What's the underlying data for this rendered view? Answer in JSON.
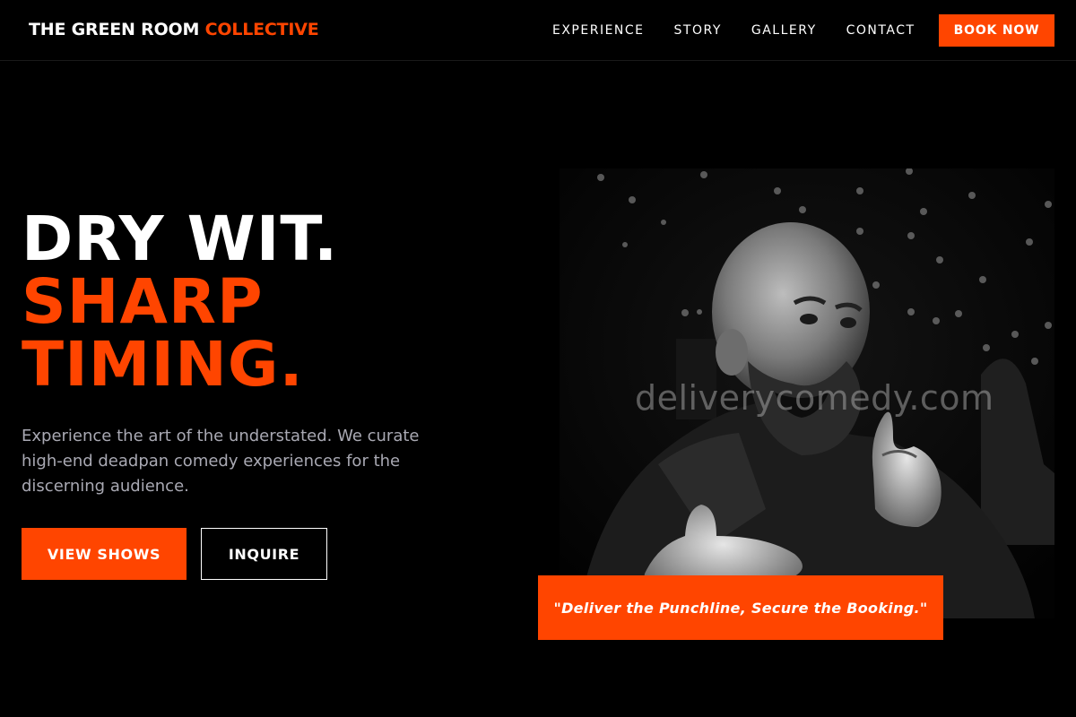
{
  "brand": {
    "name": "THE GREEN ROOM",
    "accent": "COLLECTIVE",
    "accent_color": "#ff4500"
  },
  "nav": {
    "items": [
      {
        "label": "EXPERIENCE"
      },
      {
        "label": "STORY"
      },
      {
        "label": "GALLERY"
      },
      {
        "label": "CONTACT"
      }
    ],
    "cta": "BOOK NOW"
  },
  "hero": {
    "headline_line1": "DRY WIT.",
    "headline_line2": "SHARP",
    "headline_line3": "TIMING.",
    "subtitle": "Experience the art of the understated. We curate high-end deadpan comedy experiences for the discerning audience.",
    "primary_button": "VIEW SHOWS",
    "secondary_button": "INQUIRE"
  },
  "photo": {
    "watermark": "deliverycomedy.com",
    "quote": "\"Deliver the Punchline, Secure the Booking.\""
  }
}
